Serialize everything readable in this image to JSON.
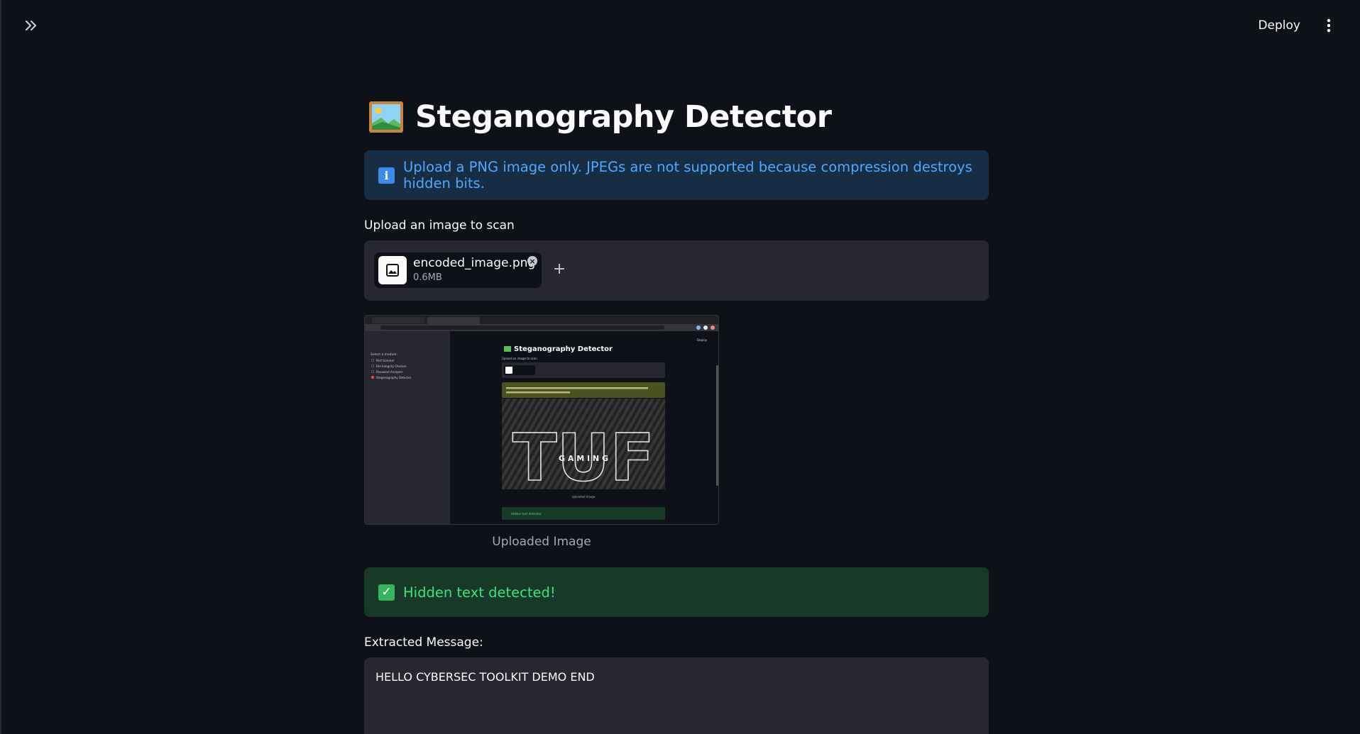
{
  "header": {
    "deploy_label": "Deploy",
    "expand_icon": "double-chevron-right-icon",
    "menu_icon": "kebab-menu-icon"
  },
  "page": {
    "title": "Steganography Detector",
    "title_icon": "framed-picture-icon"
  },
  "info_alert": {
    "text": "Upload a PNG image only. JPEGs are not supported because compression destroys hidden bits.",
    "icon": "info-icon",
    "color": "#4ea8ff"
  },
  "uploader": {
    "label": "Upload an image to scan",
    "file": {
      "name": "encoded_image.png",
      "size": "0.6MB",
      "icon": "image-file-icon"
    },
    "add_icon": "plus-icon",
    "remove_icon": "close-circle-icon"
  },
  "preview": {
    "caption": "Uploaded Image",
    "inner": {
      "title": "Steganography Detector",
      "sidebar_heading": "Select a module:",
      "sidebar_items": [
        "Port Scanner",
        "File Integrity Checker",
        "Password Analyzer",
        "Steganography Detector"
      ],
      "upload_label": "Upload an image to scan",
      "image_text_large": "TUF",
      "image_text_small": "G A M I N G",
      "inner_caption": "Uploaded Image",
      "success_text": "Hidden text detected",
      "deploy": "Deploy"
    }
  },
  "success_alert": {
    "text": "Hidden text detected!",
    "icon": "checkmark-icon",
    "color": "#3de27b"
  },
  "extracted": {
    "label": "Extracted Message:",
    "message": "HELLO CYBERSEC TOOLKIT DEMO END"
  }
}
